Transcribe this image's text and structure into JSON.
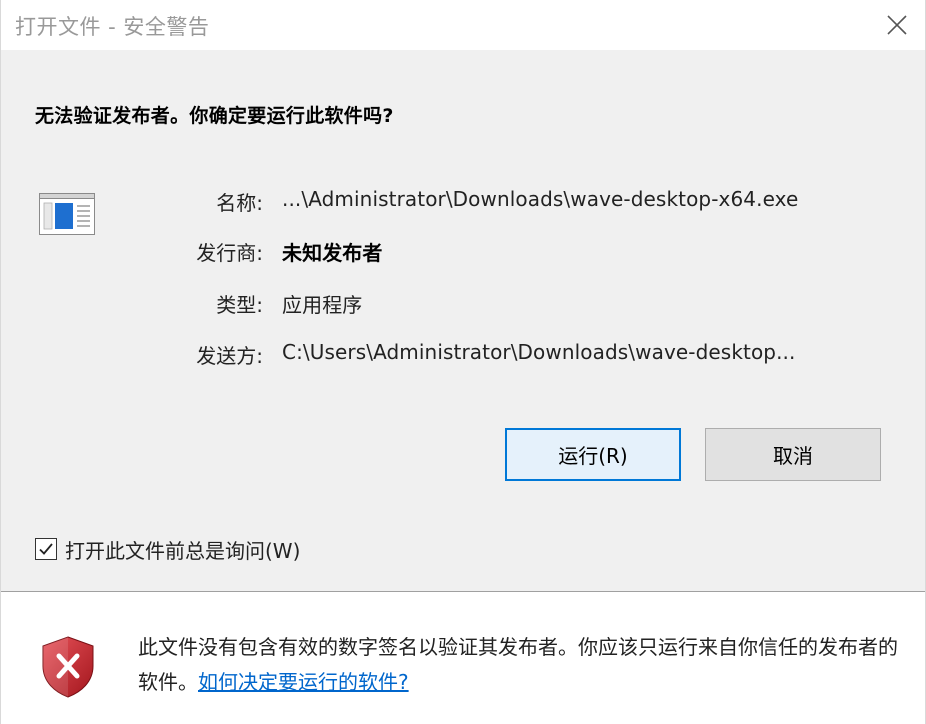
{
  "window": {
    "title": "打开文件 - 安全警告"
  },
  "dialog": {
    "heading": "无法验证发布者。你确定要运行此软件吗?",
    "fields": [
      {
        "label": "名称:",
        "value": "...\\Administrator\\Downloads\\wave-desktop-x64.exe",
        "bold": false
      },
      {
        "label": "发行商:",
        "value": "未知发布者",
        "bold": true
      },
      {
        "label": "类型:",
        "value": "应用程序",
        "bold": false
      },
      {
        "label": "发送方:",
        "value": "C:\\Users\\Administrator\\Downloads\\wave-desktop...",
        "bold": false
      }
    ],
    "run_label": "运行(R)",
    "cancel_label": "取消",
    "checkbox": {
      "label": "打开此文件前总是询问(W)",
      "checked": true
    }
  },
  "footer": {
    "warning_text": "此文件没有包含有效的数字签名以验证其发布者。你应该只运行来自你信任的发布者的软件。",
    "link_text": "如何决定要运行的软件?"
  },
  "colors": {
    "accent": "#0078d7",
    "link": "#0066cc",
    "shield_red": "#c1272d"
  },
  "icons": {
    "close": "close-icon",
    "file": "application-file-icon",
    "checkbox": "checkmark-icon",
    "shield": "shield-error-icon"
  }
}
